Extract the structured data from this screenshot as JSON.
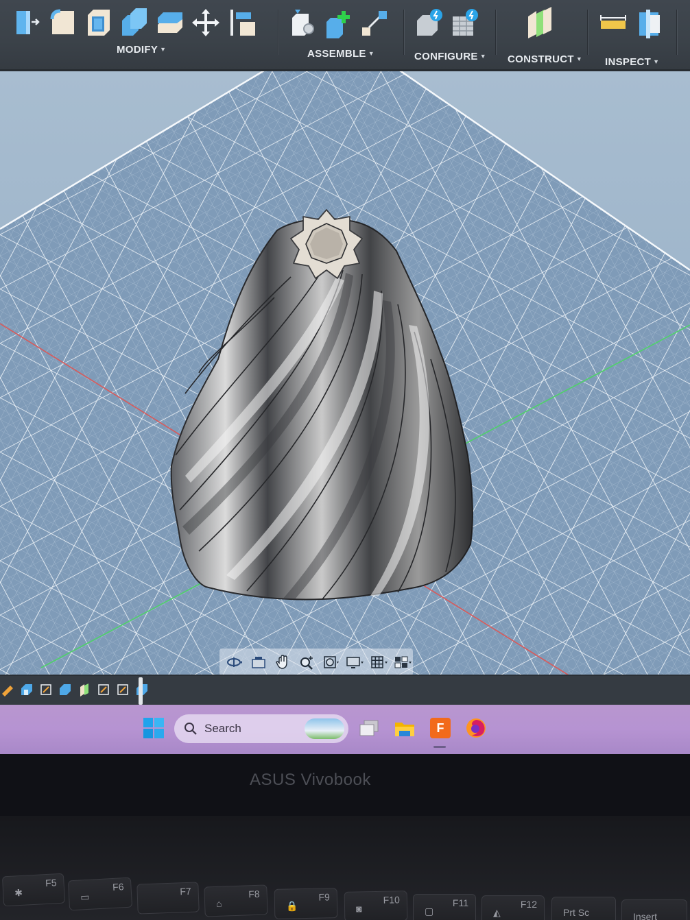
{
  "toolbar": {
    "groups": [
      {
        "label": "MODIFY",
        "icons": [
          "press-pull-icon",
          "fillet-icon",
          "shell-icon",
          "combine-icon",
          "offset-face-icon",
          "move-icon",
          "align-icon"
        ]
      },
      {
        "label": "ASSEMBLE",
        "icons": [
          "new-component-icon",
          "joint-icon",
          "as-built-joint-icon"
        ]
      },
      {
        "label": "CONFIGURE",
        "icons": [
          "configure-icon",
          "configure-table-icon"
        ]
      },
      {
        "label": "CONSTRUCT",
        "icons": [
          "offset-plane-icon"
        ]
      },
      {
        "label": "INSPECT",
        "icons": [
          "measure-icon",
          "section-analysis-icon"
        ]
      }
    ]
  },
  "colors": {
    "toolbar_bg": "#3b4249",
    "viewport_bg": "#9fb6cc",
    "grid_line": "#e8eef5",
    "x_axis": "#d95a5a",
    "y_axis": "#4fd16a",
    "taskbar_bg": "#b693d2",
    "fusion_orange": "#f26a1b"
  },
  "navbar": {
    "buttons": [
      "orbit-icon",
      "look-at-icon",
      "pan-icon",
      "zoom-icon",
      "fit-icon",
      "display-settings-icon",
      "grid-settings-icon",
      "viewports-icon"
    ]
  },
  "taskbar": {
    "search_label": "Search",
    "apps": [
      "task-view-icon",
      "file-explorer-icon",
      "fusion-icon",
      "firefox-icon"
    ],
    "fusion_letter": "F"
  },
  "laptop": {
    "brand": "ASUS Vivobook",
    "keys": [
      {
        "label": "F5"
      },
      {
        "label": "F6"
      },
      {
        "label": "F7"
      },
      {
        "label": "F8"
      },
      {
        "label": "F9"
      },
      {
        "label": "F10"
      },
      {
        "label": "F11"
      },
      {
        "label": "F12"
      },
      {
        "label": "Prt Sc"
      },
      {
        "label": "Insert"
      }
    ]
  }
}
